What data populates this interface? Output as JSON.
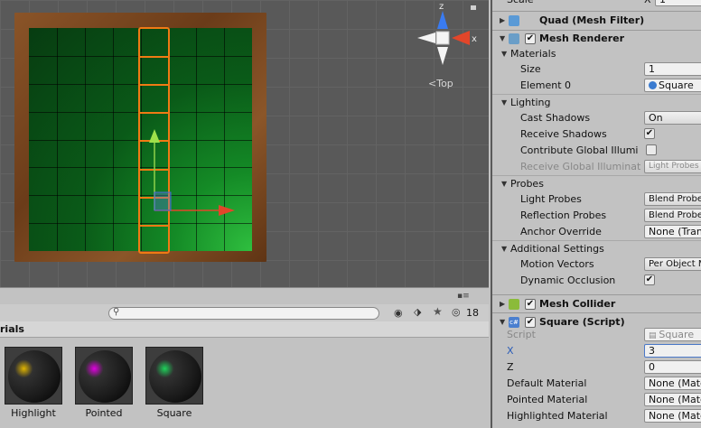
{
  "scene": {
    "gizmo_view_label": "Top",
    "gizmo_z": "z",
    "gizmo_x": "x"
  },
  "inspector": {
    "scale_partial": "Scale",
    "scale_x_label": "X",
    "scale_x_value": "1",
    "mesh_filter_title": "Quad (Mesh Filter)",
    "mesh_renderer_title": "Mesh Renderer",
    "materials_header": "Materials",
    "size_label": "Size",
    "size_value": "1",
    "element0_label": "Element 0",
    "element0_value": "Square",
    "lighting_header": "Lighting",
    "cast_shadows_label": "Cast Shadows",
    "cast_shadows_value": "On",
    "receive_shadows_label": "Receive Shadows",
    "receive_shadows_checked": true,
    "contribute_gi_label": "Contribute Global Illumi",
    "receive_gi_label": "Receive Global Illuminat",
    "receive_gi_value": "Light Probes",
    "probes_header": "Probes",
    "light_probes_label": "Light Probes",
    "light_probes_value": "Blend Probe",
    "reflection_probes_label": "Reflection Probes",
    "reflection_probes_value": "Blend Probe",
    "anchor_override_label": "Anchor Override",
    "anchor_override_value": "None (Tran",
    "additional_header": "Additional Settings",
    "motion_vectors_label": "Motion Vectors",
    "motion_vectors_value": "Per Object M",
    "dynamic_occlusion_label": "Dynamic Occlusion",
    "dynamic_occlusion_checked": true,
    "mesh_collider_title": "Mesh Collider",
    "square_script_title": "Square (Script)",
    "script_label": "Script",
    "script_value": "Square",
    "x_label": "X",
    "x_value": "3",
    "z_label": "Z",
    "z_value": "0",
    "default_material_label": "Default Material",
    "default_material_value": "None (Mate",
    "pointed_material_label": "Pointed Material",
    "pointed_material_value": "None (Mate",
    "highlighted_material_label": "Highlighted Material",
    "highlighted_material_value": "None (Mate"
  },
  "project": {
    "hidden_count": "18",
    "breadcrumb": "rials",
    "materials": [
      {
        "name": "Highlight",
        "color": "#e0b400"
      },
      {
        "name": "Pointed",
        "color": "#e000e0"
      },
      {
        "name": "Square",
        "color": "#1ed25a"
      }
    ]
  },
  "colors": {
    "selection": "#f07a14",
    "board_green": "#148a26",
    "gizmo_red": "#e2462a",
    "gizmo_blue": "#3a7bf0"
  }
}
